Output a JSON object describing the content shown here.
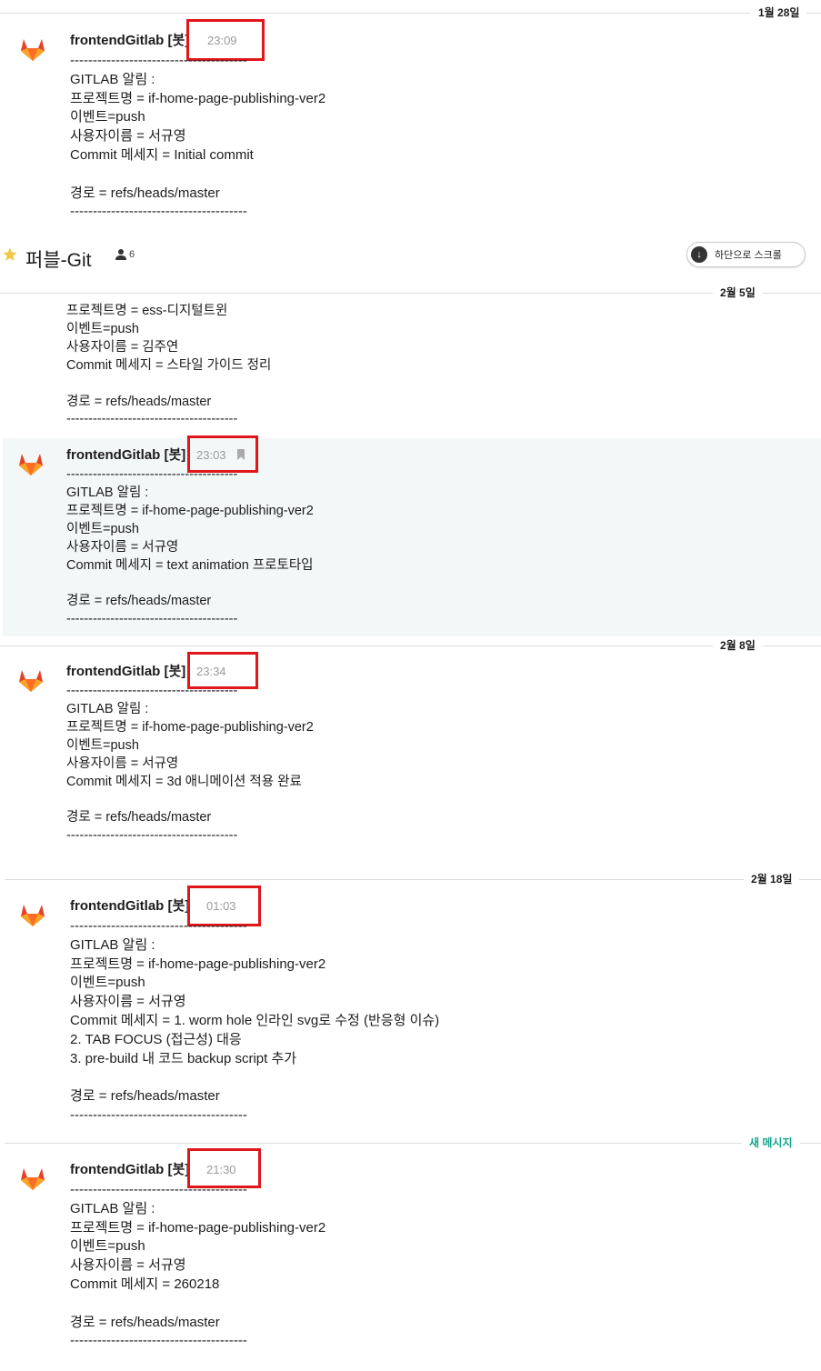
{
  "dates": {
    "d1": "1월 28일",
    "d2": "2월 5일",
    "d3": "2월 8일",
    "d4": "2월 18일",
    "new": "새 메시지"
  },
  "channel": {
    "title": "퍼블-Git",
    "member_count": "6",
    "scroll_button": "하단으로 스크롤"
  },
  "messages": [
    {
      "author": "frontendGitlab [봇]",
      "time": "23:09",
      "body": "---------------------------------------\nGITLAB 알림 :\n프로젝트명 = if-home-page-publishing-ver2\n이벤트=push\n사용자이름 = 서규영\nCommit 메세지 = Initial commit\n\n경로 = refs/heads/master\n---------------------------------------"
    },
    {
      "body": "프로젝트명 = ess-디지털트윈\n이벤트=push\n사용자이름 = 김주연\nCommit 메세지 = 스타일 가이드 정리\n\n경로 = refs/heads/master\n---------------------------------------"
    },
    {
      "author": "frontendGitlab [봇]",
      "time": "23:03",
      "body": "---------------------------------------\nGITLAB 알림 :\n프로젝트명 = if-home-page-publishing-ver2\n이벤트=push\n사용자이름 = 서규영\nCommit 메세지 = text animation 프로토타입\n\n경로 = refs/heads/master\n---------------------------------------"
    },
    {
      "author": "frontendGitlab [봇]",
      "time": "23:34",
      "body": "---------------------------------------\nGITLAB 알림 :\n프로젝트명 = if-home-page-publishing-ver2\n이벤트=push\n사용자이름 = 서규영\nCommit 메세지 = 3d 애니메이션 적용 완료\n\n경로 = refs/heads/master\n---------------------------------------"
    },
    {
      "author": "frontendGitlab [봇]",
      "time": "01:03",
      "body": "---------------------------------------\nGITLAB 알림 :\n프로젝트명 = if-home-page-publishing-ver2\n이벤트=push\n사용자이름 = 서규영\nCommit 메세지 = 1. worm hole 인라인 svg로 수정 (반응형 이슈)\n2. TAB FOCUS (접근성) 대응\n3. pre-build 내 코드 backup script 추가\n\n경로 = refs/heads/master\n---------------------------------------"
    },
    {
      "author": "frontendGitlab [봇]",
      "time": "21:30",
      "body": "---------------------------------------\nGITLAB 알림 :\n프로젝트명 = if-home-page-publishing-ver2\n이벤트=push\n사용자이름 = 서규영\nCommit 메세지 = 260218\n\n경로 = refs/heads/master\n---------------------------------------"
    }
  ],
  "colors": {
    "highlight_box": "#e0161b",
    "gitlab_orange": "#e24329",
    "new_message": "#12a38a",
    "hover_bg": "#f4f7f8"
  }
}
